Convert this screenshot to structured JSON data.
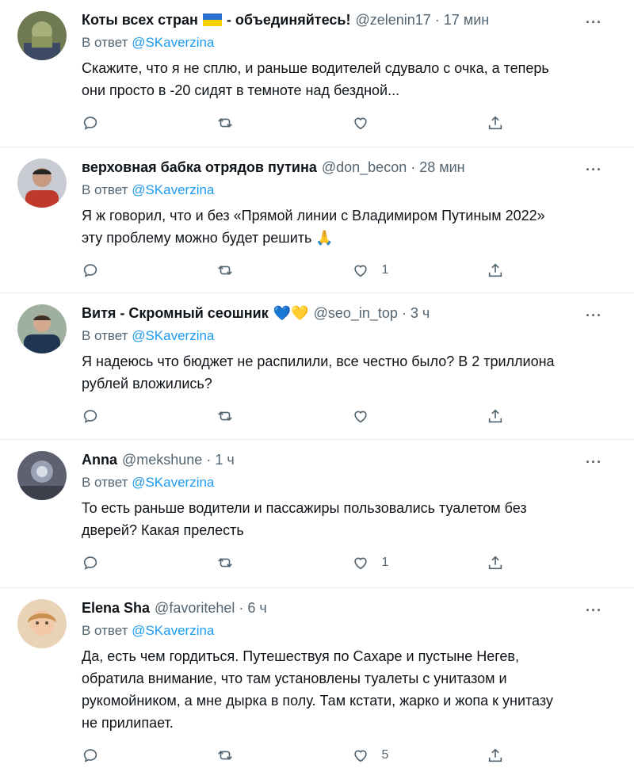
{
  "colors": {
    "accent": "#1d9bf0",
    "muted": "#536471",
    "divider": "#e6ecf0"
  },
  "reply_prefix": "В ответ",
  "icons": [
    "reply-icon",
    "retweet-icon",
    "like-icon",
    "share-icon",
    "more-icon"
  ],
  "more_label": "···",
  "separator": "·",
  "tweets": [
    {
      "name": "Коты всех стран",
      "name_suffix": "- объединяйтесь!",
      "has_flag": true,
      "handle": "@zelenin17",
      "time": "17 мин",
      "reply_to": "@SKaverzina",
      "text": "Скажите, что я не сплю, и раньше водителей сдувало с очка, а теперь\nони просто в -20 сидят в темноте над бездной...",
      "likes": ""
    },
    {
      "name": "верховная бабка отрядов путина",
      "handle": "@don_becon",
      "time": "28 мин",
      "reply_to": "@SKaverzina",
      "text": "Я ж говорил, что и без «Прямой линии с Владимиром Путиным 2022»\nэту проблему можно будет решить 🙏",
      "likes": "1"
    },
    {
      "name": "Витя - Скромный сеошник",
      "name_emoji": "💙💛",
      "handle": "@seo_in_top",
      "time": "3 ч",
      "reply_to": "@SKaverzina",
      "text": "Я надеюсь что бюджет не распилили, все честно было? В 2 триллиона\nрублей вложились?",
      "likes": ""
    },
    {
      "name": "Anna",
      "handle": "@mekshune",
      "time": "1 ч",
      "reply_to": "@SKaverzina",
      "text": "То есть раньше водители и пассажиры пользовались туалетом без\nдверей? Какая прелесть",
      "likes": "1"
    },
    {
      "name": "Elena Sha",
      "handle": "@favoritehel",
      "time": "6 ч",
      "reply_to": "@SKaverzina",
      "text": "Да, есть чем гордиться. Путешествуя по Сахаре и пустыне Негев,\nобратила внимание, что там установлены туалеты с унитазом и\nрукомойником, а мне дырка в полу. Там кстати, жарко и жопа к унитазу\nне прилипает.",
      "likes": "5"
    }
  ]
}
